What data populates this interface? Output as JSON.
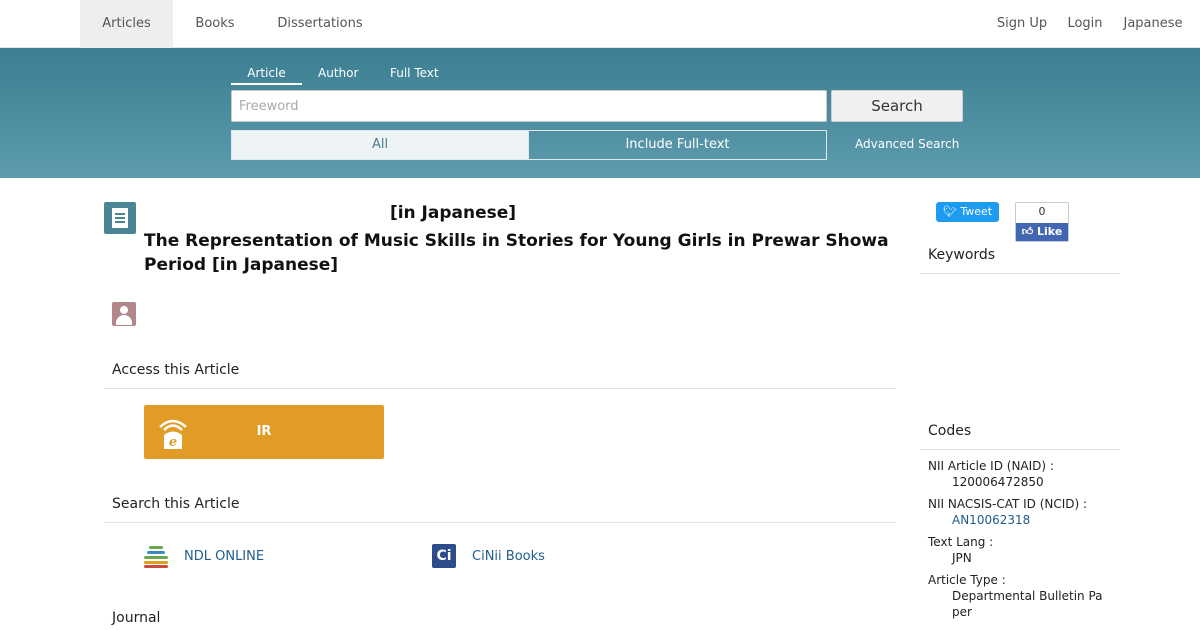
{
  "topnav": {
    "left": [
      "Articles",
      "Books",
      "Dissertations"
    ],
    "right": [
      "Sign Up",
      "Login",
      "Japanese"
    ]
  },
  "search": {
    "tabs": [
      "Article",
      "Author",
      "Full Text"
    ],
    "placeholder": "Freeword",
    "button": "Search",
    "scope_all": "All",
    "scope_fulltext": "Include Full-text",
    "advanced": "Advanced Search"
  },
  "article": {
    "title_alt": "[in Japanese]",
    "title": "The Representation of Music Skills in Stories for Young Girls in Prewar Showa Period  [in Japanese]"
  },
  "access": {
    "heading": "Access this Article",
    "ir_label": "IR"
  },
  "search_article": {
    "heading": "Search this Article",
    "ndl": "NDL ONLINE",
    "cinii": "CiNii Books",
    "cinii_icon": "Ci"
  },
  "journal": {
    "heading": "Journal"
  },
  "sidebar": {
    "tweet": "Tweet",
    "like_count": "0",
    "like": "Like",
    "keywords_heading": "Keywords",
    "codes_heading": "Codes",
    "codes": [
      {
        "label": "NII Article ID (NAID) :",
        "value": "120006472850"
      },
      {
        "label": "NII NACSIS-CAT ID (NCID) :",
        "value": "AN10062318"
      },
      {
        "label": "Text Lang :",
        "value": "JPN"
      },
      {
        "label": "Article Type :",
        "value_line1": "Departmental Bulletin Pa",
        "value_line2": "per"
      }
    ]
  },
  "colors": {
    "band": "#4d8ea0",
    "ir_button": "#e09c26",
    "link": "#1f5d8c",
    "tweet": "#1d9bf0",
    "fb_like": "#4267b2"
  },
  "icons": [
    "document-icon",
    "author-avatar-icon",
    "ir-repository-icon",
    "ndl-online-icon",
    "cinii-books-icon",
    "twitter-icon",
    "facebook-like-icon"
  ]
}
